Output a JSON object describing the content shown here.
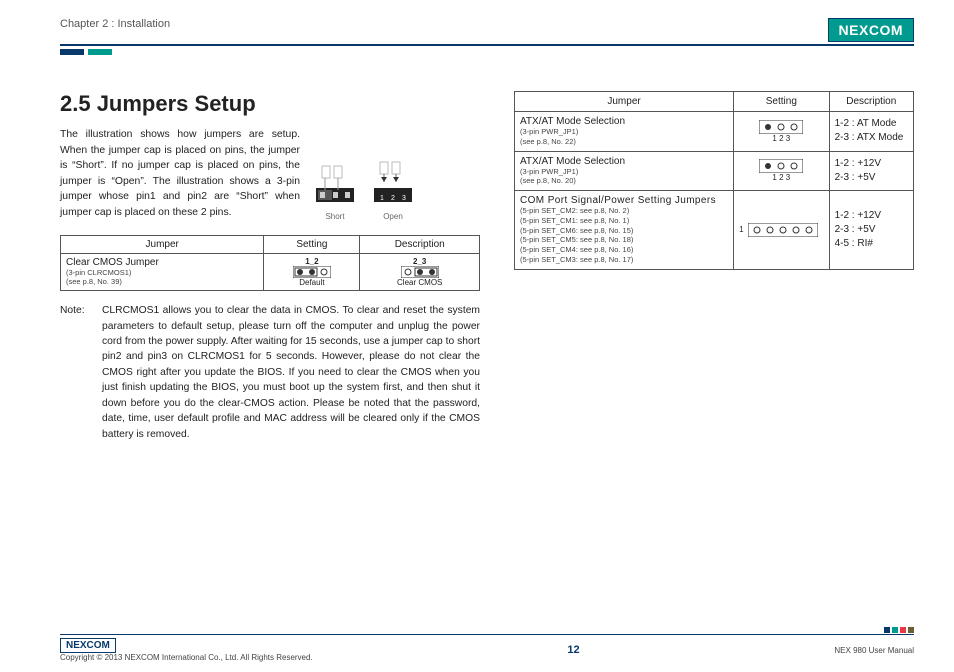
{
  "header": {
    "chapter": "Chapter 2 : Installation",
    "logo": "NEXCOM"
  },
  "section": {
    "title": "2.5 Jumpers Setup",
    "intro": "The illustration shows how jumpers are setup. When the jumper cap is placed on pins, the jumper is “Short”. If no jumper cap is placed on pins, the jumper is “Open”. The illustration shows a 3-pin jumper whose pin1 and pin2 are “Short” when jumper cap is placed on these 2 pins."
  },
  "illus": {
    "short": "Short",
    "open": "Open"
  },
  "left_table": {
    "headers": [
      "Jumper",
      "Setting",
      "Description"
    ],
    "row": {
      "name": "Clear CMOS Jumper",
      "sub1": "(3-pin CLRCMOS1)",
      "sub2": "(see p.8, No. 39)",
      "setting_label_top": "1_2",
      "setting_label_bot": "Default",
      "desc_label_top": "2_3",
      "desc_label_bot": "Clear CMOS"
    }
  },
  "note": {
    "label": "Note:",
    "body": "CLRCMOS1 allows you to clear the data in CMOS. To clear and reset the system parameters to default setup, please turn off the computer and unplug the power cord from the power supply. After waiting for 15 seconds, use a jumper cap to short pin2 and pin3 on CLRCMOS1 for 5 seconds. However, please do not clear the CMOS right after you update the BIOS. If you need to clear the CMOS when you just finish updating the BIOS, you must boot up the system first, and then shut it down before you do the clear-CMOS action. Please be noted that the password, date, time, user default profile and MAC address will be cleared only if the CMOS battery is removed."
  },
  "right_table": {
    "headers": [
      "Jumper",
      "Setting",
      "Description"
    ],
    "rows": [
      {
        "name": "ATX/AT Mode Selection",
        "sub1": "(3-pin PWR_JP1)",
        "sub2": "(see p.8, No. 22)",
        "pins_label": "1  2  3",
        "desc1": "1-2 : AT Mode",
        "desc2": "2-3 : ATX Mode"
      },
      {
        "name": "ATX/AT Mode Selection",
        "sub1": "(3-pin PWR_JP1)",
        "sub2": "(see p.8, No. 20)",
        "pins_label": "1  2  3",
        "desc1": "1-2 : +12V",
        "desc2": "2-3 : +5V"
      },
      {
        "name": "COM Port Signal/Power Setting Jumpers",
        "subs": [
          "(5-pin SET_CM2: see p.8, No. 2)",
          "(5-pin SET_CM1: see p.8, No. 1)",
          "(5-pin SET_CM6: see p.8, No. 15)",
          "(5-pin SET_CM5: see p.8, No. 18)",
          "(5-pin SET_CM4: see p.8, No. 16)",
          "(5-pin SET_CM3: see p.8, No. 17)"
        ],
        "pins_left_label": "1",
        "desc1": "1-2 : +12V",
        "desc2": "2-3 : +5V",
        "desc3": "4-5 : RI#"
      }
    ]
  },
  "footer": {
    "logo": "NEXCOM",
    "copyright": "Copyright © 2013 NEXCOM International Co., Ltd. All Rights Reserved.",
    "page": "12",
    "manual": "NEX 980 User Manual"
  }
}
